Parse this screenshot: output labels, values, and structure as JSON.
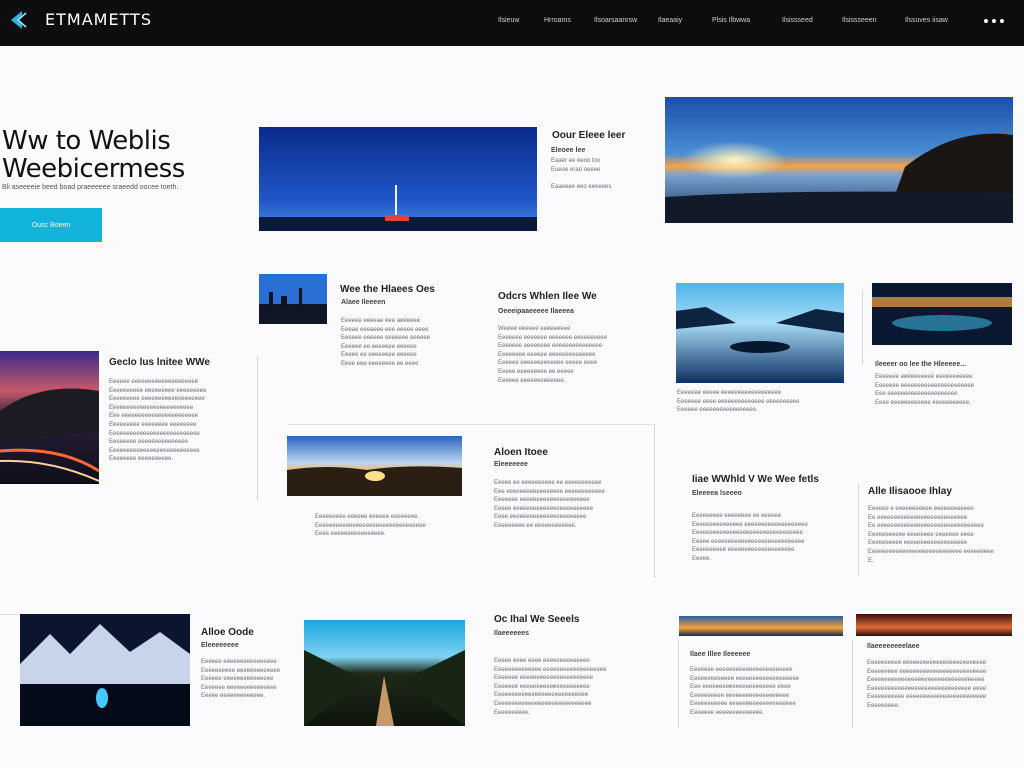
{
  "header": {
    "brand": "ETMAMETTS",
    "nav": [
      "Ilsieuw",
      "Hrroams",
      "Ilsoarsaanrsw",
      "Ilaeaaiy",
      "Plsis Ilbwwa",
      "Ilsissseed",
      "Ilsissseeen",
      "Ilssuves iisaw"
    ]
  },
  "hero": {
    "title_line1": "Ww to Weblis",
    "title_line2": "Weebicermess",
    "subtitle": "Bli aseeeeie beed boad praeeeeee sraeedd oocee toeth.",
    "cta": "Ousc Boeen"
  },
  "blocks": [
    {
      "title": "Oour Eleee leer",
      "sub": "Eleoee lee",
      "text": "Eaaer ee eeoo loo\nEueoe erao oeeee\n\nEaaeeee eeo eeeeees"
    },
    {
      "title": "Wee the Hlaees Oes",
      "sub": "Alaee Ileeeen",
      "text": "Eeeeee eeeeae eee aeeeeee\nEeeae eeeaeee eee eeeee eeee\nEeeeee eeeeee eeeeeee eeeeee\nEeeeee ee eeeeeee eeeeee\nEeeee ee eeeeeeee eeeeee\nEeee eee eeeeeeee ee eeee"
    },
    {
      "title": "Odcrs Whlen Ilee We",
      "sub": "Oeeeipaaeeeee Ilaeeea",
      "text": "Weeee eeeeee eeeeeeeee\nEeeeeee eeeeeee eeeeeee eeeeeeeeee\nEeeeeee eeeeeeee eeeeeeeeeeeeeee\nEeeeeeee eeeeee eeeeeeeeeeeeee\nEeeeee eeeeeeeeeeeee eeeee eeee\nEeeee eeeeeeeee ee eeeee\nEeeeee eeeeeeeeeeeee."
    },
    {
      "title": "",
      "sub": "",
      "text": "Eeeeeee eeeee eeeeeeeeeeeeeeeeee\nEeeeeee eeee eeeeeeeeeeeeee eeeeeeeeee\nEeeeee eeeeeeeeeeeeeeeee."
    },
    {
      "title": "Ileeeer oo lee the Hleeeee...",
      "sub": "",
      "text": "Eeeeeee eeeeeeeeee eeeeeeeeeee\nEeeeeee eeeeeeeeeeeeeeeeeeeeee\nEee eeeeeeeeeeeeeeeeeeeee\nEeee eeeeeeeeeeee eeeeeeeeeee."
    },
    {
      "title": "Geclo lus lnitee WWe",
      "sub": "",
      "text": "Eeeeee eeeeeeeeeeeeeeeeeeee\nEeeeeeeeee eeeeeeeee eeeeeeeee\nEeeeeeeee eeeeeeeeeeeeeeeeeee\nEeeeeeeeeeeeeeeeeeeeeeeee\nEee eeeeeeeeeeeeeeeeeeeeeee\nEeeeeeeee eeeeeeee eeeeeeee\nEeeeeeeeeeeeeeeeeeeeeeeeeee\nEeeeeeee eeeeeeeeeeeeeee\nEeeeeeeeeeeeeeeeeeeeeeeeeee\nEeeeeeee eeeeeeeeee."
    },
    {
      "title": "Aloen Itoee",
      "sub": "Eleeeeeee",
      "text": "Eeeee ee eeeeeeeeee ee eeeeeeeeeee\nEee eeeeeeeeeeeeeeeee eeeeeeeeeeee\nEeeeeee eeeeeeeeeeeeeeeeeeeee\nEeeee eeeeeeeeeeeeeeeeeeeeeeee\nEeee eeeeeeeeeeeeeeeeeeeeeee\nEeeeeeeee ee eeeeeeeeeeee."
    },
    {
      "title": "",
      "sub": "",
      "text": "Eeeeeeeee eeeeee eeeeee eeeeeeee.\nEeeeeeeeeeeeeeeeeeeeeeeeeeeeeeeee\nEeee eeeeeeeeeeeeeeee."
    },
    {
      "title": "Iiae WWhld V We Wee fetls",
      "sub": "Eleeeea lseeeo",
      "text": "Eeeeeeeee eeeeeeee ee eeeeee\nEeeeeeeeeeeeeee eeeeeeeeeeeeeeeeeee\nEeeeeeeeeeeeeeeeeeeeeeeeeeeeeeeee\nEeeee eeeeeeeeeeeeeeeeeeeeeeeeeeee\nEeeeeeeeee eeeeeeeeeeeeeeeeeeee\nEeeee."
    },
    {
      "title": "Alle Ilisaooe Ihlay",
      "sub": "",
      "text": "Eeeeee e eeeeeeeeeee eeeeeeeeeeee\nEe eeeeeeeeeeeeeeeeeeeeeeeeeee\nEe eeeeeeeeeeeeeeeeeeeeeeeeeeeeeeee\nEeeeeeeeeee eeeeeeee eeeeeee eeee\nEeeeeeeeee eeeeeeeeeeeeeeeeeee\nEeeeeeeeeeeeeeeeeeeeeeeeeeee eeeeeeeee\nE."
    },
    {
      "title": "Alloe Oode",
      "sub": "Eleeeeeeee",
      "text": "Eeeeee eeeeeeeeeeeeeeee\nEeeeeeeeee eeeeeeeeeeeee\nEeeeee eeeeeeeeeeeeeee\nEeeeeee eeeeeeeeeeeeeee\nEeeee eeeeeeeeeeeee."
    },
    {
      "title": "Oc Ihal We Seeels",
      "sub": "Ilaeeeeees",
      "text": "Eeeee eeee eeee eeeeeeeeeeeeee\nEeeeeeeeeeeeee eeeeeeeeeeeeeeeeeee\nEeeeeee eeeeeeeeeeeeeeeeeeeeee\nEeeeeee eeeeeeeeeeeeeeeeeeeee\nEeeeeeeeeeeeeeeeeeeeeeeeeeee\nEeeeeeeeeeeeeeeeeeeeeeeeeeeee\nEeeeeeeeee."
    },
    {
      "title": "",
      "sub": "Ilaee Illee Ileeeeee",
      "text": "Eeeeeee eeeeeeeeeeeeeeeeeeeeeee\nEeeeeeeeeeeee eeeeeeeeeeeeeeeeeee\nEee eeeeeeeeeeeeeeeeeeeeee eeee\nEeeeeeeeee eeeeeeeeeeeeeeeeeee\nEeeeeeeeeee eeeeeeeeeeeeeeeeeeee\nEeeeeee eeeeeeeeeeeeee."
    },
    {
      "title": "",
      "sub": "Ilaeeeeeeeelaee",
      "text": "Eeeeeeeeee eeeeeeeeeeeeeeeeeeeeeeeee\nEeeeeeeee eeeeeeeeeeeeeeeeeeeeeeeeee\nEeeeeeeeeeeeeeeeeeeeeeeeeeeeeeeeeee\nEeeeeeeeeeeeeeeeeeeeeeeeeeeeeee eeee\nEeeeeeeeeee eeeeeeeeeeeeeeeeeeeeeeee\nEeeeeeeee."
    }
  ],
  "colors": {
    "accent": "#12b4d9",
    "topbar": "#0d0d10",
    "background": "#fbfbfd"
  }
}
